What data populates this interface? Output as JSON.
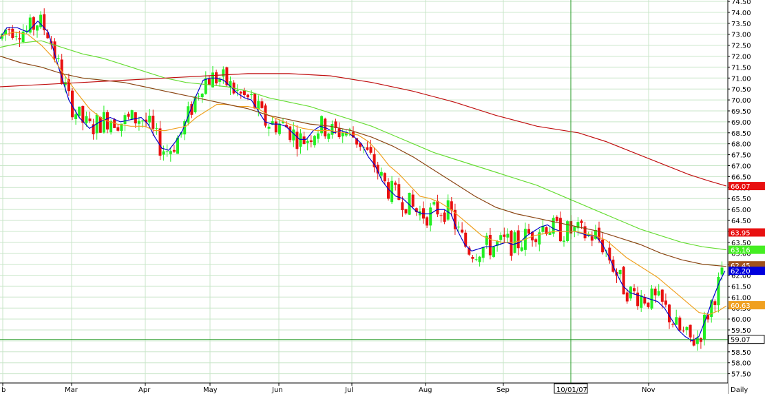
{
  "chart_data": {
    "type": "candlestick",
    "grid": true,
    "price_axis_side": "right",
    "ylim": [
      57.5,
      74.5
    ],
    "yticks": [
      "74.50",
      "74.00",
      "73.50",
      "73.00",
      "72.50",
      "72.00",
      "71.50",
      "71.00",
      "70.50",
      "70.00",
      "69.50",
      "69.00",
      "68.50",
      "68.00",
      "67.50",
      "67.00",
      "66.50",
      "66.00",
      "65.50",
      "65.00",
      "64.50",
      "64.00",
      "63.50",
      "63.00",
      "62.50",
      "62.00",
      "61.50",
      "61.00",
      "60.50",
      "60.00",
      "59.50",
      "59.00",
      "58.50",
      "58.00",
      "57.50"
    ],
    "months": [
      "b",
      "Mar",
      "Apr",
      "May",
      "Jun",
      "Jul",
      "Aug",
      "Sep",
      "Oct",
      "Nov"
    ],
    "timeframe_label": "Daily",
    "cursor_date_label": "10/01/07",
    "cursor_price_label": "59.07",
    "cursor_price": 59.07,
    "cursor_month_index": 8,
    "value_tags": [
      {
        "label": "66.07",
        "value": 66.07,
        "color": "#e81010",
        "text_color": "#ffffff"
      },
      {
        "label": "63.95",
        "value": 63.95,
        "color": "#e81010",
        "text_color": "#ffffff"
      },
      {
        "label": "63.16",
        "value": 63.16,
        "color": "#44ee22",
        "text_color": "#ffffff"
      },
      {
        "label": "62.45",
        "value": 62.45,
        "color": "#a0521c",
        "text_color": "#ffffff"
      },
      {
        "label": "62.20",
        "value": 62.2,
        "color": "#0000dd",
        "text_color": "#ffffff"
      },
      {
        "label": "60.63",
        "value": 60.63,
        "color": "#f0a020",
        "text_color": "#ffffff"
      }
    ],
    "colors": {
      "up": "#22ee22",
      "down": "#e81010",
      "grid": "#c8e6c8"
    },
    "series": [
      {
        "name": "",
        "color": "#0000cc",
        "values": [
          [
            0,
            72.8
          ],
          [
            10,
            73.3
          ],
          [
            25,
            73.3
          ],
          [
            40,
            73.1
          ],
          [
            55,
            73.6
          ],
          [
            70,
            73.1
          ],
          [
            85,
            71.5
          ],
          [
            100,
            70.0
          ],
          [
            115,
            69.2
          ],
          [
            130,
            68.7
          ],
          [
            145,
            69.0
          ],
          [
            160,
            69.2
          ],
          [
            175,
            69.0
          ],
          [
            190,
            69.1
          ],
          [
            205,
            69.2
          ],
          [
            215,
            68.9
          ],
          [
            225,
            68.3
          ],
          [
            235,
            67.8
          ],
          [
            245,
            67.7
          ],
          [
            255,
            68.1
          ],
          [
            265,
            68.6
          ],
          [
            275,
            69.4
          ],
          [
            285,
            70.2
          ],
          [
            295,
            70.9
          ],
          [
            305,
            71.0
          ],
          [
            315,
            71.0
          ],
          [
            325,
            70.9
          ],
          [
            335,
            70.6
          ],
          [
            345,
            70.3
          ],
          [
            355,
            70.1
          ],
          [
            365,
            70.0
          ],
          [
            375,
            69.5
          ],
          [
            385,
            69.0
          ],
          [
            395,
            68.9
          ],
          [
            405,
            68.9
          ],
          [
            415,
            68.8
          ],
          [
            425,
            68.5
          ],
          [
            435,
            68.2
          ],
          [
            445,
            68.2
          ],
          [
            455,
            68.6
          ],
          [
            465,
            68.8
          ],
          [
            475,
            68.7
          ],
          [
            485,
            68.5
          ],
          [
            495,
            68.6
          ],
          [
            505,
            68.5
          ],
          [
            515,
            68.3
          ],
          [
            525,
            68.0
          ],
          [
            535,
            67.4
          ],
          [
            545,
            67.0
          ],
          [
            555,
            66.3
          ],
          [
            565,
            65.9
          ],
          [
            575,
            65.6
          ],
          [
            585,
            65.5
          ],
          [
            595,
            65.2
          ],
          [
            605,
            64.9
          ],
          [
            615,
            64.8
          ],
          [
            625,
            64.8
          ],
          [
            635,
            65.0
          ],
          [
            645,
            65.0
          ],
          [
            655,
            64.8
          ],
          [
            665,
            64.0
          ],
          [
            675,
            63.4
          ],
          [
            685,
            63.1
          ],
          [
            695,
            63.2
          ],
          [
            705,
            63.3
          ],
          [
            715,
            63.3
          ],
          [
            725,
            63.4
          ],
          [
            735,
            63.5
          ],
          [
            745,
            63.4
          ],
          [
            755,
            63.5
          ],
          [
            765,
            63.8
          ],
          [
            775,
            64.0
          ],
          [
            785,
            64.2
          ],
          [
            795,
            64.3
          ],
          [
            805,
            64.1
          ],
          [
            815,
            64.0
          ],
          [
            825,
            64.0
          ],
          [
            835,
            64.0
          ],
          [
            845,
            63.9
          ],
          [
            855,
            63.8
          ],
          [
            865,
            63.8
          ],
          [
            875,
            63.4
          ],
          [
            885,
            62.8
          ],
          [
            895,
            62.1
          ],
          [
            905,
            61.5
          ],
          [
            915,
            61.2
          ],
          [
            925,
            61.1
          ],
          [
            935,
            61.0
          ],
          [
            945,
            60.9
          ],
          [
            955,
            60.8
          ],
          [
            965,
            60.5
          ],
          [
            975,
            60.0
          ],
          [
            985,
            59.5
          ],
          [
            995,
            59.2
          ],
          [
            1005,
            59.0
          ],
          [
            1015,
            59.2
          ],
          [
            1025,
            60.0
          ],
          [
            1035,
            60.9
          ],
          [
            1045,
            61.7
          ],
          [
            1053,
            62.2
          ]
        ]
      },
      {
        "name": "",
        "color": "#f0a020",
        "values": [
          [
            0,
            72.9
          ],
          [
            20,
            73.1
          ],
          [
            40,
            73.0
          ],
          [
            60,
            72.5
          ],
          [
            75,
            72.0
          ],
          [
            90,
            71.3
          ],
          [
            110,
            70.4
          ],
          [
            130,
            69.6
          ],
          [
            150,
            69.1
          ],
          [
            170,
            68.9
          ],
          [
            190,
            68.8
          ],
          [
            210,
            68.8
          ],
          [
            225,
            68.6
          ],
          [
            240,
            68.6
          ],
          [
            255,
            68.7
          ],
          [
            270,
            68.8
          ],
          [
            285,
            69.2
          ],
          [
            300,
            69.5
          ],
          [
            315,
            69.8
          ],
          [
            330,
            69.8
          ],
          [
            345,
            69.7
          ],
          [
            360,
            69.7
          ],
          [
            375,
            69.6
          ],
          [
            390,
            69.3
          ],
          [
            405,
            69.1
          ],
          [
            420,
            68.9
          ],
          [
            440,
            68.7
          ],
          [
            460,
            68.6
          ],
          [
            480,
            68.6
          ],
          [
            500,
            68.5
          ],
          [
            520,
            68.4
          ],
          [
            535,
            68.1
          ],
          [
            550,
            67.6
          ],
          [
            565,
            67.0
          ],
          [
            580,
            66.6
          ],
          [
            595,
            66.1
          ],
          [
            610,
            65.6
          ],
          [
            625,
            65.5
          ],
          [
            640,
            65.3
          ],
          [
            655,
            65.0
          ],
          [
            670,
            64.6
          ],
          [
            685,
            64.2
          ],
          [
            700,
            63.8
          ],
          [
            715,
            63.6
          ],
          [
            730,
            63.5
          ],
          [
            745,
            63.5
          ],
          [
            760,
            63.6
          ],
          [
            775,
            63.8
          ],
          [
            790,
            63.9
          ],
          [
            805,
            64.0
          ],
          [
            820,
            64.0
          ],
          [
            835,
            64.0
          ],
          [
            850,
            63.9
          ],
          [
            865,
            63.8
          ],
          [
            880,
            63.6
          ],
          [
            895,
            63.2
          ],
          [
            910,
            62.8
          ],
          [
            925,
            62.5
          ],
          [
            940,
            62.2
          ],
          [
            955,
            61.9
          ],
          [
            970,
            61.5
          ],
          [
            985,
            61.1
          ],
          [
            1000,
            60.7
          ],
          [
            1015,
            60.3
          ],
          [
            1030,
            60.2
          ],
          [
            1045,
            60.4
          ],
          [
            1055,
            60.6
          ]
        ]
      },
      {
        "name": "",
        "color": "#8b4513",
        "values": [
          [
            0,
            72.0
          ],
          [
            30,
            71.7
          ],
          [
            60,
            71.5
          ],
          [
            90,
            71.2
          ],
          [
            120,
            71.0
          ],
          [
            150,
            70.9
          ],
          [
            180,
            70.8
          ],
          [
            210,
            70.6
          ],
          [
            240,
            70.4
          ],
          [
            270,
            70.2
          ],
          [
            300,
            70.0
          ],
          [
            330,
            69.8
          ],
          [
            360,
            69.6
          ],
          [
            390,
            69.3
          ],
          [
            420,
            69.1
          ],
          [
            450,
            68.9
          ],
          [
            480,
            68.8
          ],
          [
            510,
            68.6
          ],
          [
            540,
            68.3
          ],
          [
            570,
            67.9
          ],
          [
            600,
            67.4
          ],
          [
            630,
            66.8
          ],
          [
            660,
            66.2
          ],
          [
            690,
            65.6
          ],
          [
            720,
            65.1
          ],
          [
            750,
            64.8
          ],
          [
            780,
            64.6
          ],
          [
            810,
            64.4
          ],
          [
            840,
            64.2
          ],
          [
            870,
            64.0
          ],
          [
            900,
            63.7
          ],
          [
            930,
            63.4
          ],
          [
            960,
            63.0
          ],
          [
            990,
            62.7
          ],
          [
            1020,
            62.5
          ],
          [
            1055,
            62.4
          ]
        ]
      },
      {
        "name": "",
        "color": "#66dd33",
        "values": [
          [
            0,
            72.4
          ],
          [
            30,
            72.6
          ],
          [
            60,
            72.7
          ],
          [
            90,
            72.4
          ],
          [
            120,
            72.1
          ],
          [
            150,
            71.9
          ],
          [
            180,
            71.6
          ],
          [
            210,
            71.3
          ],
          [
            240,
            71.0
          ],
          [
            270,
            70.8
          ],
          [
            300,
            70.7
          ],
          [
            330,
            70.6
          ],
          [
            360,
            70.4
          ],
          [
            390,
            70.1
          ],
          [
            420,
            69.9
          ],
          [
            450,
            69.7
          ],
          [
            480,
            69.4
          ],
          [
            510,
            69.1
          ],
          [
            540,
            68.8
          ],
          [
            570,
            68.4
          ],
          [
            600,
            68.0
          ],
          [
            630,
            67.6
          ],
          [
            660,
            67.3
          ],
          [
            690,
            67.0
          ],
          [
            720,
            66.7
          ],
          [
            750,
            66.4
          ],
          [
            780,
            66.1
          ],
          [
            810,
            65.7
          ],
          [
            840,
            65.3
          ],
          [
            870,
            64.9
          ],
          [
            900,
            64.5
          ],
          [
            930,
            64.1
          ],
          [
            960,
            63.8
          ],
          [
            990,
            63.5
          ],
          [
            1020,
            63.3
          ],
          [
            1055,
            63.16
          ]
        ]
      },
      {
        "name": "",
        "color": "#c01010",
        "values": [
          [
            0,
            70.6
          ],
          [
            60,
            70.7
          ],
          [
            120,
            70.8
          ],
          [
            180,
            70.9
          ],
          [
            240,
            71.0
          ],
          [
            300,
            71.1
          ],
          [
            360,
            71.2
          ],
          [
            420,
            71.2
          ],
          [
            480,
            71.1
          ],
          [
            540,
            70.8
          ],
          [
            600,
            70.4
          ],
          [
            660,
            69.9
          ],
          [
            720,
            69.3
          ],
          [
            780,
            68.8
          ],
          [
            840,
            68.5
          ],
          [
            880,
            68.1
          ],
          [
            920,
            67.6
          ],
          [
            960,
            67.1
          ],
          [
            1000,
            66.6
          ],
          [
            1030,
            66.3
          ],
          [
            1055,
            66.07
          ]
        ]
      }
    ]
  }
}
